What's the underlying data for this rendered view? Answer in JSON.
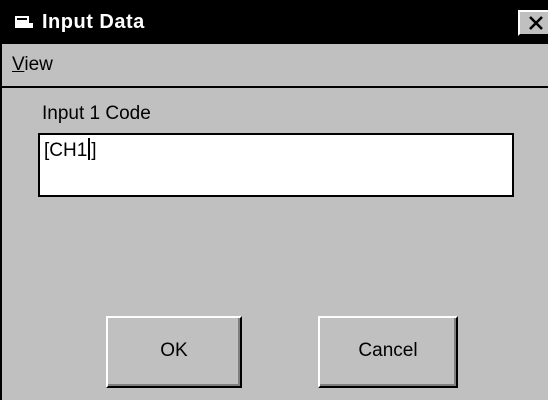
{
  "window": {
    "title": "Input Data",
    "icon": "window-icon",
    "close_icon": "close-icon",
    "close_glyph": "✕"
  },
  "menubar": {
    "items": [
      {
        "label_first": "V",
        "label_rest": "iew"
      }
    ]
  },
  "form": {
    "field_label": "Input 1 Code",
    "field_value_before_caret": "[CH1",
    "field_value_after_caret": "]"
  },
  "buttons": {
    "ok_label": "OK",
    "cancel_label": "Cancel"
  },
  "colors": {
    "window_bg": "#c0c0c0",
    "titlebar_bg": "#000000",
    "titlebar_text": "#ffffff",
    "input_bg": "#ffffff"
  }
}
